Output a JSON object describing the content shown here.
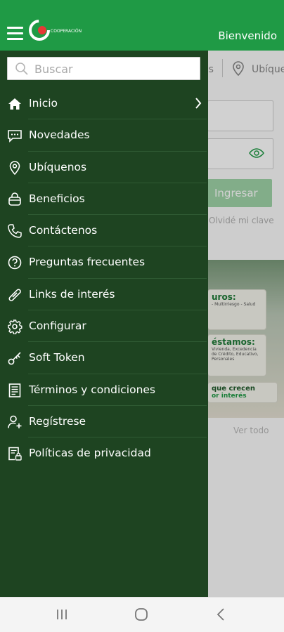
{
  "header": {
    "welcome_text": "Bienvenido",
    "logo_text": "COOPERACIÓN",
    "brand_color": "#1f9a45"
  },
  "drawer": {
    "background_color": "#1e4421",
    "search": {
      "placeholder": "Buscar",
      "value": ""
    },
    "items": [
      {
        "label": "Inicio",
        "icon": "home-icon",
        "has_chevron": true
      },
      {
        "label": "Novedades",
        "icon": "chat-icon"
      },
      {
        "label": "Ubíquenos",
        "icon": "location-pin-icon"
      },
      {
        "label": "Beneficios",
        "icon": "bag-icon"
      },
      {
        "label": "Contáctenos",
        "icon": "phone-icon"
      },
      {
        "label": "Preguntas frecuentes",
        "icon": "question-icon"
      },
      {
        "label": "Links de interés",
        "icon": "link-icon"
      },
      {
        "label": "Configurar",
        "icon": "gear-icon"
      },
      {
        "label": "Soft Token",
        "icon": "key-icon"
      },
      {
        "label": "Términos y condiciones",
        "icon": "document-icon"
      },
      {
        "label": "Regístrese",
        "icon": "user-add-icon"
      },
      {
        "label": "Políticas de privacidad",
        "icon": "policy-icon"
      }
    ]
  },
  "background": {
    "tab_fragment_1": "es",
    "tab_fragment_2": "Ubíquen",
    "login_button": "Ingresar",
    "forgot_text": "Olvidé mi clave",
    "banner": {
      "card1_title": "uros:",
      "card1_sub": "- Multirriesgo - Salud",
      "card2_title": "éstamos:",
      "card2_sub": "Vivienda, Excedencia de Crédito, Educativo, Personales",
      "card3_title": "que crecen",
      "card3_sub": "or interés"
    },
    "view_all": "Ver todo"
  }
}
